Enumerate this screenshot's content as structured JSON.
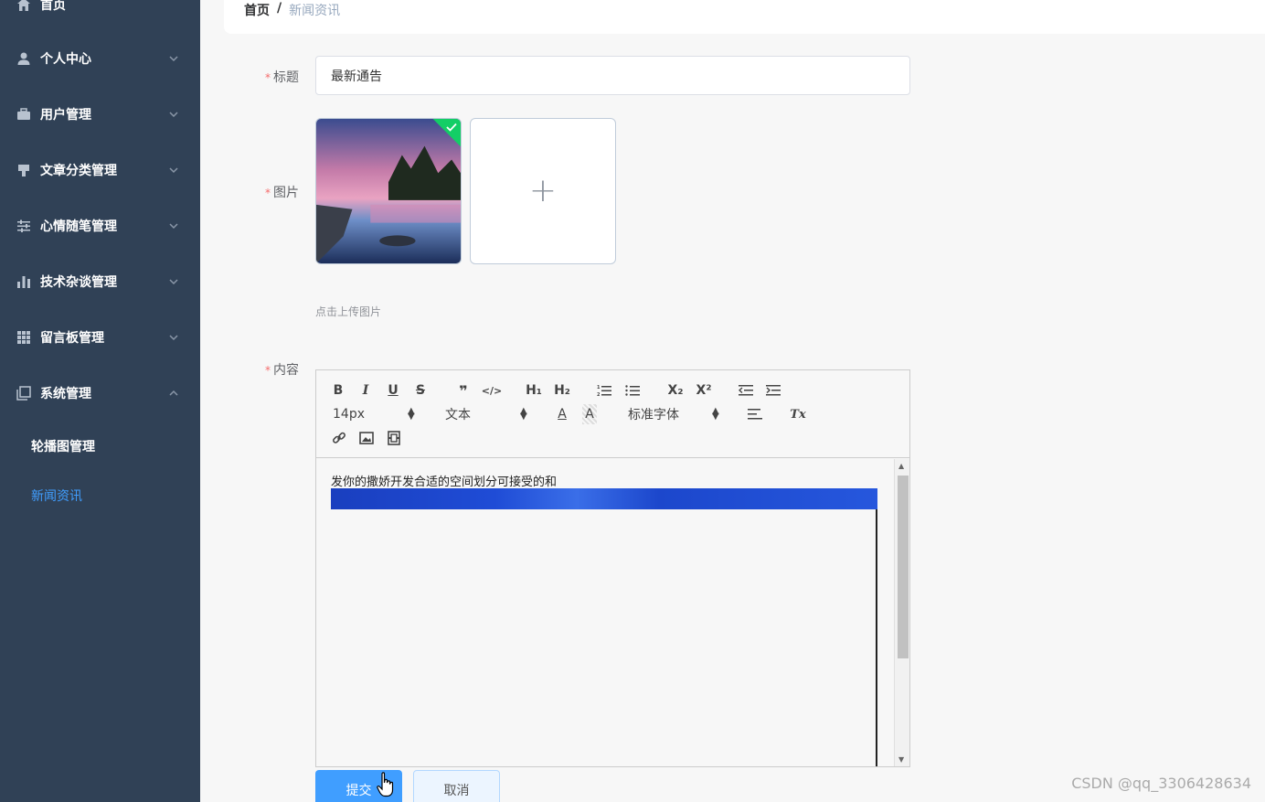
{
  "sidebar": {
    "items": [
      {
        "label": "首页",
        "icon": "home-icon"
      },
      {
        "label": "个人中心",
        "icon": "user-icon"
      },
      {
        "label": "用户管理",
        "icon": "briefcase-icon"
      },
      {
        "label": "文章分类管理",
        "icon": "flag-icon"
      },
      {
        "label": "心情随笔管理",
        "icon": "sliders-icon"
      },
      {
        "label": "技术杂谈管理",
        "icon": "bar-chart-icon"
      },
      {
        "label": "留言板管理",
        "icon": "grid-icon"
      },
      {
        "label": "系统管理",
        "icon": "copy-icon"
      }
    ],
    "sub_items": [
      {
        "label": "轮播图管理"
      },
      {
        "label": "新闻资讯"
      }
    ]
  },
  "breadcrumb": {
    "home": "首页",
    "separator": "/",
    "current": "新闻资讯"
  },
  "form": {
    "title_label": "标题",
    "title_value": "最新通告",
    "image_label": "图片",
    "upload_tip": "点击上传图片",
    "content_label": "内容",
    "required_mark": "*"
  },
  "editor": {
    "toolbar": {
      "bold": "B",
      "italic": "I",
      "underline": "U",
      "strike": "S",
      "blockquote": "❞",
      "code": "</>",
      "h1": "H₁",
      "h2": "H₂",
      "ordered_list": "ordered-list-icon",
      "bullet_list": "bullet-list-icon",
      "subscript": "X₂",
      "superscript": "X²",
      "size_value": "14px",
      "header_value": "文本",
      "font_value": "标准字体",
      "color_label": "A",
      "background_label": "A",
      "clean_label": "Tx"
    },
    "content_text": "发你的撒娇开发合适的空间划分可接受的和"
  },
  "buttons": {
    "submit": "提交",
    "cancel": "取消"
  },
  "watermark": "CSDN @qq_3306428634",
  "colors": {
    "sidebar_bg": "#304156",
    "primary": "#409eff",
    "active_text": "#409eff",
    "success": "#13ce66"
  }
}
